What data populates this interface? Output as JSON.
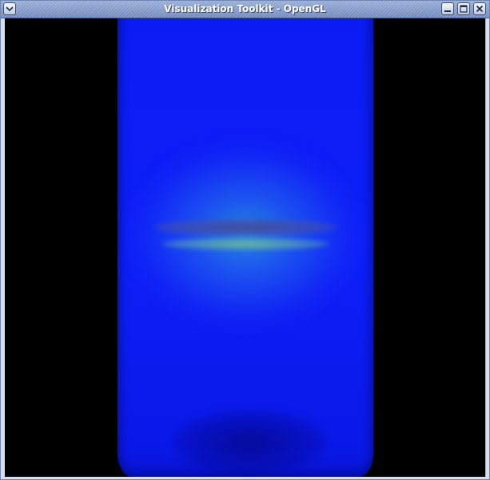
{
  "window": {
    "title": "Visualization Toolkit - OpenGL"
  },
  "titlebar": {
    "menu_icon": "chevron-down-icon",
    "minimize_icon": "minimize-icon",
    "maximize_icon": "maximize-icon",
    "close_icon": "close-icon"
  },
  "render": {
    "background_color": "#000000",
    "volume_color": "#0d1ff8",
    "highlight_color": "#2896dc"
  }
}
